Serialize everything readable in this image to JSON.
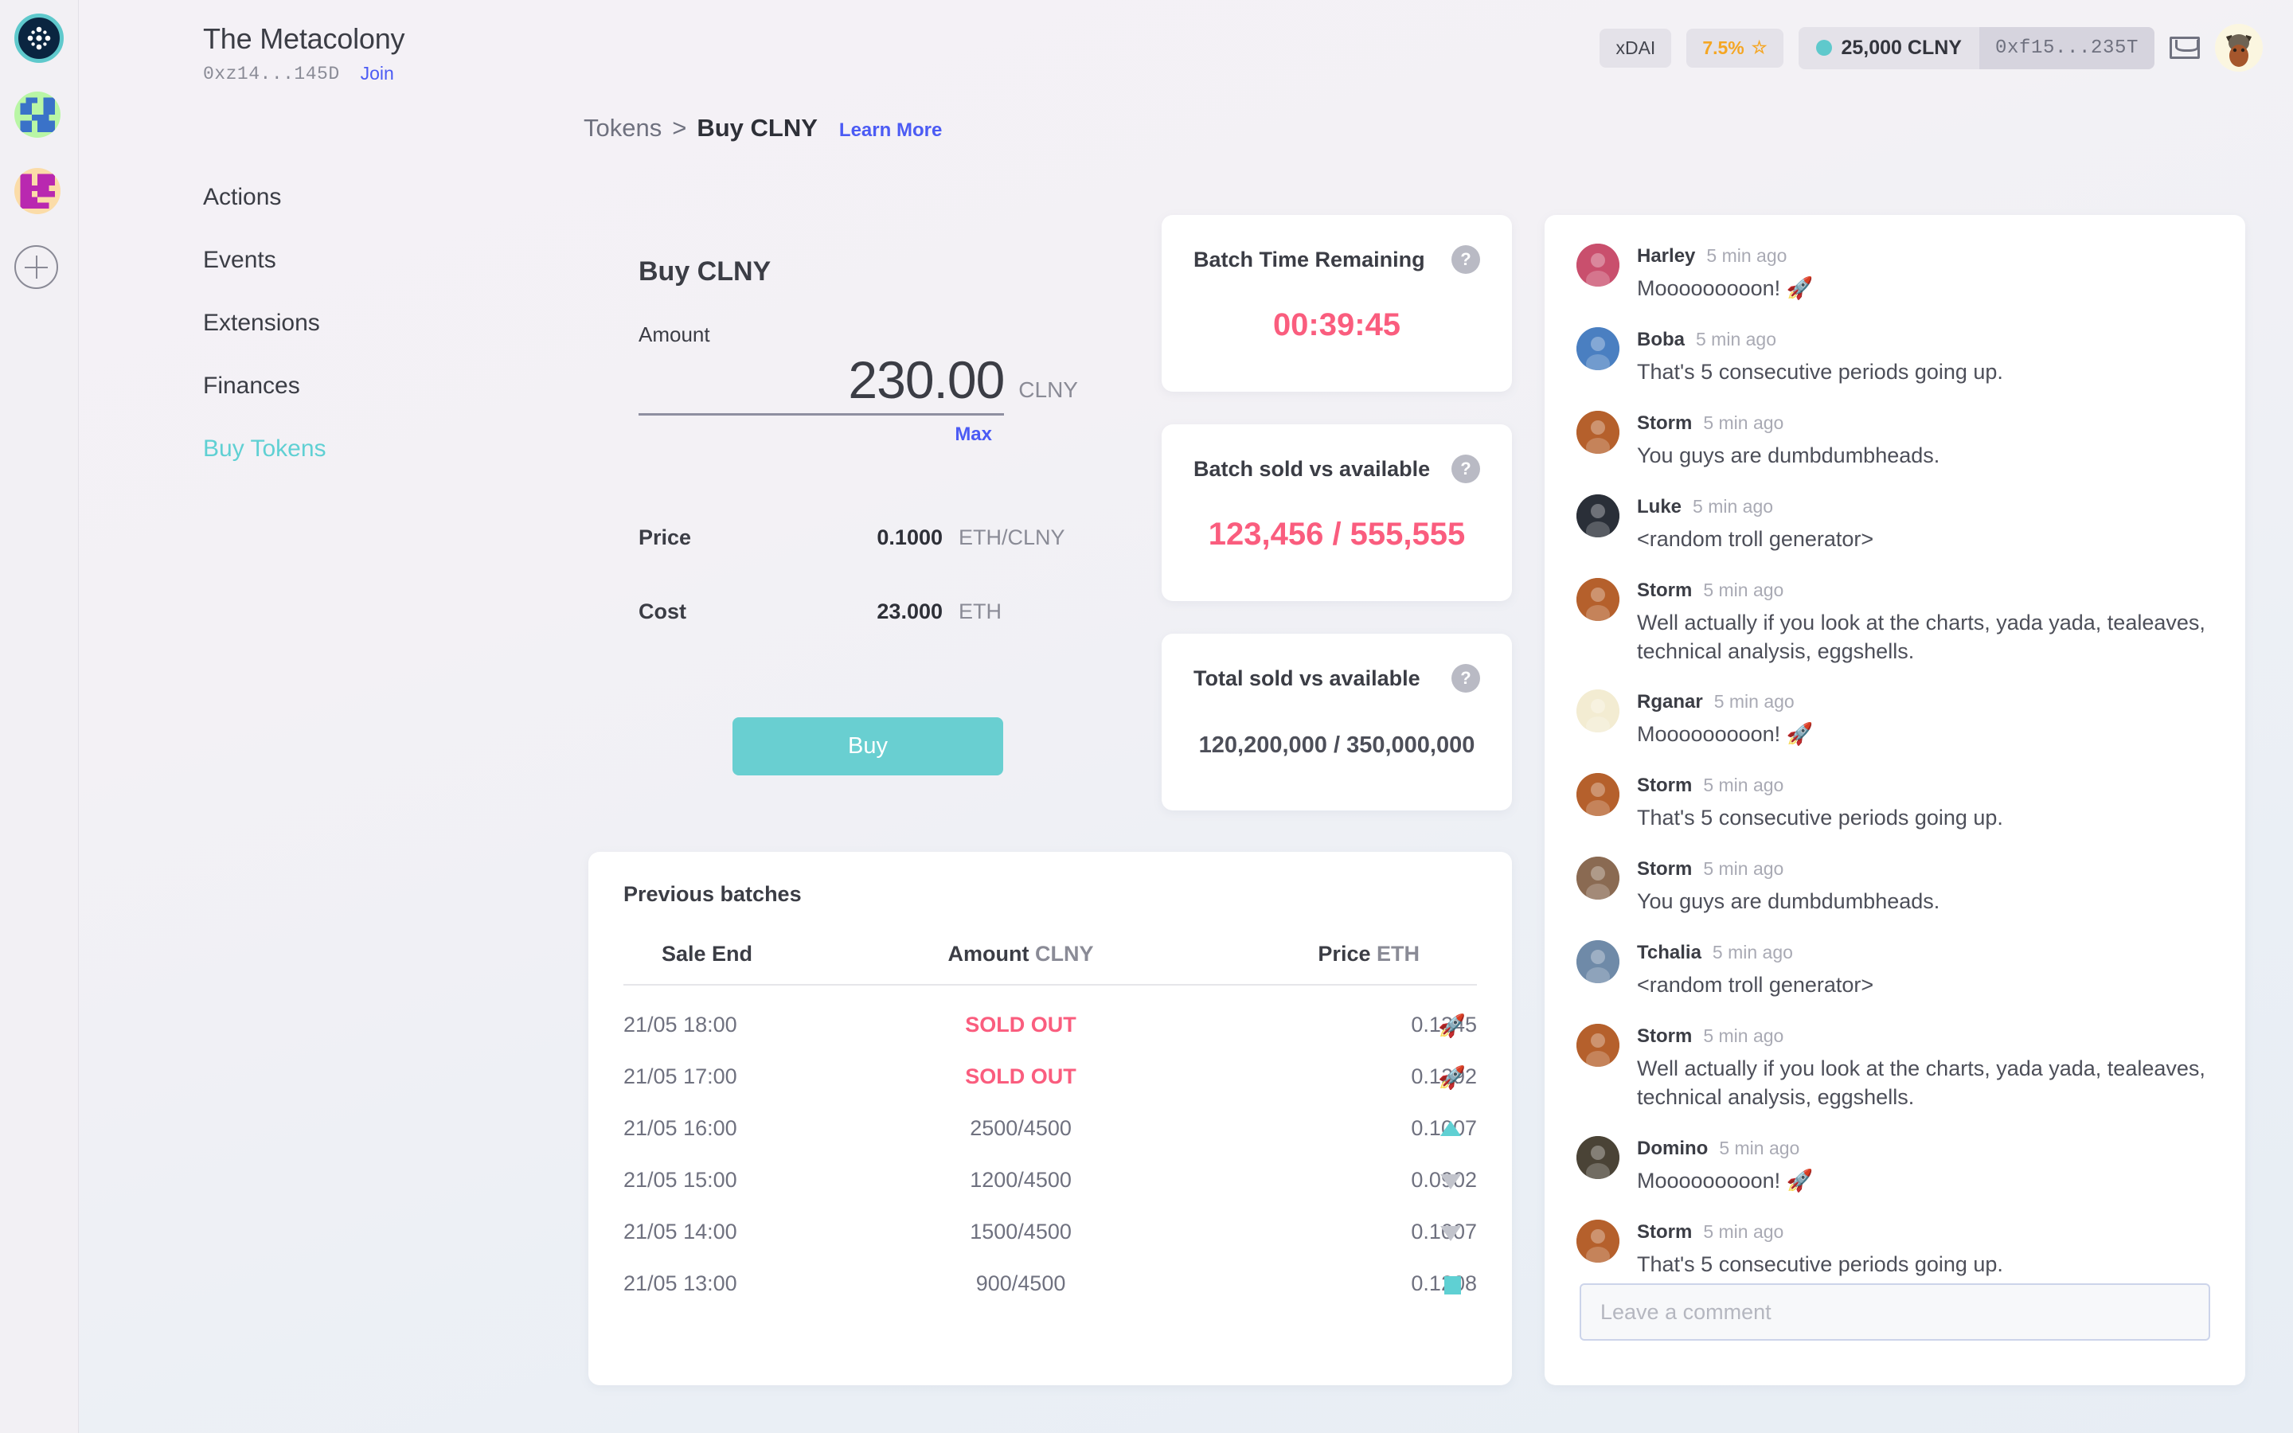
{
  "rail": {
    "items": [
      {
        "name": "colony-home",
        "icon": "colony-logo-icon"
      },
      {
        "name": "colony-avatar-1",
        "icon": "identicon-blue-icon"
      },
      {
        "name": "colony-avatar-2",
        "icon": "identicon-magenta-icon"
      },
      {
        "name": "add-colony",
        "icon": "plus-circle-icon"
      }
    ]
  },
  "header": {
    "colony_name": "The Metacolony",
    "colony_address": "0xz14...145D",
    "join_label": "Join",
    "network_pill": "xDAI",
    "reputation_pill": "7.5%",
    "star_glyph": "☆",
    "wallet_balance": "25,000 CLNY",
    "wallet_address": "0xf15...235T"
  },
  "breadcrumb": {
    "parent": "Tokens",
    "separator": ">",
    "current": "Buy CLNY",
    "learn_more": "Learn More"
  },
  "nav": {
    "items": [
      {
        "label": "Actions",
        "active": false
      },
      {
        "label": "Events",
        "active": false
      },
      {
        "label": "Extensions",
        "active": false
      },
      {
        "label": "Finances",
        "active": false
      },
      {
        "label": "Buy Tokens",
        "active": true
      }
    ]
  },
  "buy_form": {
    "title": "Buy CLNY",
    "amount_label": "Amount",
    "amount_value": "230.00",
    "amount_unit": "CLNY",
    "max_label": "Max",
    "price_label": "Price",
    "price_value": "0.1000",
    "price_unit": "ETH/CLNY",
    "cost_label": "Cost",
    "cost_value": "23.000",
    "cost_unit": "ETH",
    "buy_button": "Buy"
  },
  "stats": [
    {
      "title": "Batch Time Remaining",
      "value": "00:39:45",
      "help": "?",
      "emphasis": true
    },
    {
      "title": "Batch sold vs available",
      "value": "123,456 / 555,555",
      "help": "?",
      "emphasis": true
    },
    {
      "title": "Total sold vs available",
      "value": "120,200,000 / 350,000,000",
      "help": "?",
      "emphasis": false
    }
  ],
  "batches": {
    "title": "Previous batches",
    "columns": {
      "sale_end": "Sale End",
      "amount": "Amount",
      "amount_unit": "CLNY",
      "price": "Price",
      "price_unit": "ETH"
    },
    "rows": [
      {
        "sale_end": "21/05 18:00",
        "amount": "SOLD OUT",
        "sold_out": true,
        "price": "0.1345",
        "trend": "rocket"
      },
      {
        "sale_end": "21/05 17:00",
        "amount": "SOLD OUT",
        "sold_out": true,
        "price": "0.1292",
        "trend": "rocket"
      },
      {
        "sale_end": "21/05 16:00",
        "amount": "2500/4500",
        "sold_out": false,
        "price": "0.1007",
        "trend": "up"
      },
      {
        "sale_end": "21/05 15:00",
        "amount": "1200/4500",
        "sold_out": false,
        "price": "0.0902",
        "trend": "down"
      },
      {
        "sale_end": "21/05 14:00",
        "amount": "1500/4500",
        "sold_out": false,
        "price": "0.1007",
        "trend": "down"
      },
      {
        "sale_end": "21/05 13:00",
        "amount": "900/4500",
        "sold_out": false,
        "price": "0.1208",
        "trend": "flat"
      }
    ]
  },
  "comments": {
    "items": [
      {
        "author": "Harley",
        "time": "5 min ago",
        "text": "Mooooooooon! 🚀",
        "avatar": "#c94f6d"
      },
      {
        "author": "Boba",
        "time": "5 min ago",
        "text": "That's 5 consecutive periods going up.",
        "avatar": "#4a7fc1"
      },
      {
        "author": "Storm",
        "time": "5 min ago",
        "text": "You guys are dumbdumbheads.",
        "avatar": "#b5602c"
      },
      {
        "author": "Luke",
        "time": "5 min ago",
        "text": "<random troll generator>",
        "avatar": "#2a2f38"
      },
      {
        "author": "Storm",
        "time": "5 min ago",
        "text": "Well actually if you look at the charts, yada yada, tealeaves, technical analysis, eggshells.",
        "avatar": "#b5602c"
      },
      {
        "author": "Rganar",
        "time": "5 min ago",
        "text": "Mooooooooon! 🚀",
        "avatar": "#f3ecd2"
      },
      {
        "author": "Storm",
        "time": "5 min ago",
        "text": "That's 5 consecutive periods going up.",
        "avatar": "#b5602c"
      },
      {
        "author": "Storm",
        "time": "5 min ago",
        "text": "You guys are dumbdumbheads.",
        "avatar": "#8a6a52"
      },
      {
        "author": "Tchalia",
        "time": "5 min ago",
        "text": "<random troll generator>",
        "avatar": "#6f8aa8"
      },
      {
        "author": "Storm",
        "time": "5 min ago",
        "text": "Well actually if you look at the charts, yada yada, tealeaves, technical analysis, eggshells.",
        "avatar": "#b5602c"
      },
      {
        "author": "Domino",
        "time": "5 min ago",
        "text": "Mooooooooon! 🚀",
        "avatar": "#4a4336"
      },
      {
        "author": "Storm",
        "time": "5 min ago",
        "text": "That's 5 consecutive periods going up.",
        "avatar": "#b5602c"
      }
    ],
    "input_placeholder": "Leave a comment"
  },
  "colors": {
    "accent_teal": "#5fd0d3",
    "accent_blue": "#4b5bf4",
    "alert_pink": "#fa5d7e",
    "reputation_orange": "#f5a623"
  }
}
